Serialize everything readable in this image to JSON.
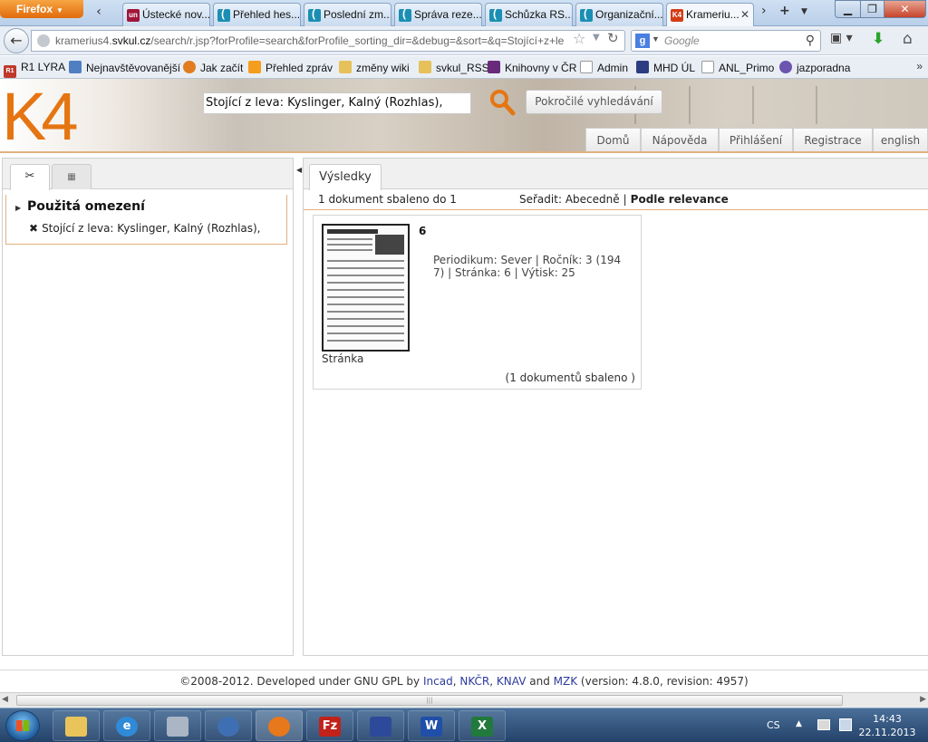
{
  "browser": {
    "app_button": "Firefox",
    "tabs": [
      {
        "label": "Ústecké nov...",
        "icon": "un-icon"
      },
      {
        "label": "Přehled hes...",
        "icon": "bracket-icon"
      },
      {
        "label": "Poslední zm...",
        "icon": "bracket-icon"
      },
      {
        "label": "Správa reze...",
        "icon": "bracket-icon"
      },
      {
        "label": "Schůzka RS...",
        "icon": "bracket-icon"
      },
      {
        "label": "Organizační...",
        "icon": "bracket-icon"
      },
      {
        "label": "Krameriu...",
        "icon": "k4-icon",
        "active": true
      }
    ],
    "url_prefix": "kramerius4.",
    "url_host": "svkul.cz",
    "url_rest": "/search/r.jsp?forProfile=search&forProfile_sorting_dir=&debug=&sort=&q=Stojící+z+le",
    "search_placeholder": "Google",
    "search_engine_letter": "g"
  },
  "bookmarks": [
    {
      "label": "R1 LYRA",
      "icon": "r1-icon"
    },
    {
      "label": "Nejnavštěvovanější",
      "icon": "star-icon"
    },
    {
      "label": "Jak začít",
      "icon": "firefox-icon"
    },
    {
      "label": "Přehled zpráv",
      "icon": "rss-icon"
    },
    {
      "label": "změny wiki",
      "icon": "folder-icon"
    },
    {
      "label": "svkul_RSS",
      "icon": "folder-icon"
    },
    {
      "label": "Knihovny v ČR",
      "icon": "book-icon"
    },
    {
      "label": "Admin",
      "icon": "page-icon"
    },
    {
      "label": "MHD ÚL",
      "icon": "mhd-icon"
    },
    {
      "label": "ANL_Primo",
      "icon": "page-icon"
    },
    {
      "label": "jazporadna",
      "icon": "jazporadna-icon"
    }
  ],
  "site": {
    "logo": "K4",
    "search_value": "Stojící z leva: Kyslinger, Kalný (Rozhlas),",
    "advanced_search": "Pokročilé vyhledávání",
    "nav": [
      "Domů",
      "Nápověda",
      "Přihlášení",
      "Registrace",
      "english"
    ]
  },
  "left_panel": {
    "heading": "Použitá omezení",
    "filter": "Stojící z leva: Kyslinger, Kalný (Rozhlas),"
  },
  "results": {
    "tab_label": "Výsledky",
    "count_text": "1 dokument  sbaleno do 1",
    "sort_label": "Seřadit:",
    "sort_alpha": "Abecedně",
    "sort_sep": "|",
    "sort_relevance": "Podle relevance",
    "item": {
      "title": "6",
      "meta": "Periodikum: Sever   |  Ročník: 3 (1947)   |  Stránka: 6     |  Výtisk: 25",
      "type": "Stránka",
      "collapsed": "(1 dokumentů sbaleno )"
    }
  },
  "footer": {
    "prefix": "©2008-2012. Developed under GNU GPL by",
    "org1": "Incad",
    "sep1": ",",
    "org2": "NKČR",
    "sep2": ",",
    "org3": "KNAV",
    "and": "and",
    "org4": "MZK",
    "suffix": "(version: 4.8.0, revision: 4957)"
  },
  "taskbar": {
    "apps": [
      "explorer",
      "internet-explorer",
      "calculator",
      "thunderbird",
      "firefox",
      "filezilla",
      "save",
      "word",
      "excel"
    ],
    "lang": "CS",
    "time": "14:43",
    "date": "22.11.2013"
  },
  "colors": {
    "accent_orange": "#e57512",
    "border_orange": "#e2b07d",
    "link_blue": "#2d3b9d"
  }
}
